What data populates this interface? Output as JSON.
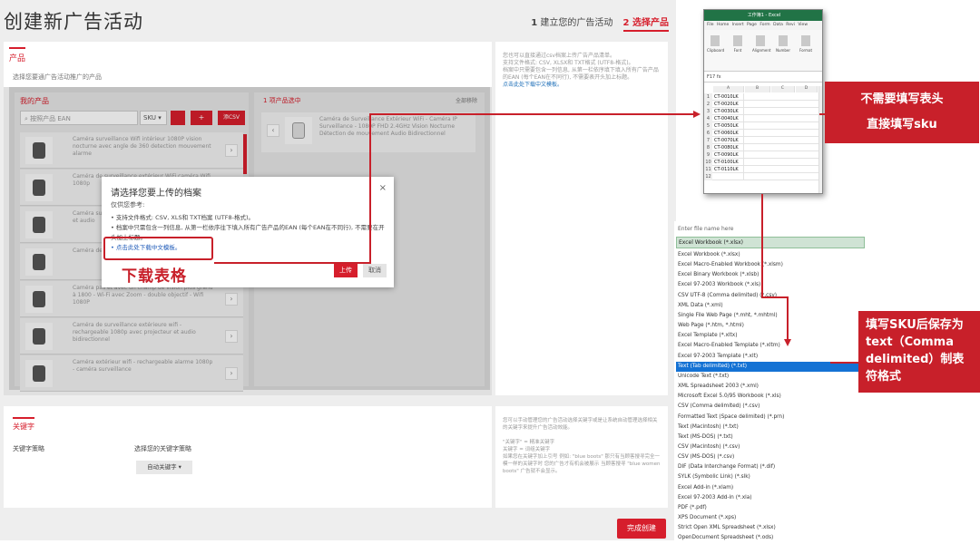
{
  "page": {
    "title": "创建新广告活动"
  },
  "steps": {
    "step1_num": "1",
    "step1": "建立您的广告活动",
    "step2_num": "2",
    "step2": "选择产品"
  },
  "products": {
    "tab": "产品",
    "subtitle": "选择您要通广告活动推广的产品",
    "my_products": {
      "header": "我的产品",
      "search_placeholder": "按照产品 EAN",
      "sku_select": "SKU ▾",
      "plus": "+",
      "csv": "添CSV",
      "items": [
        {
          "text": "Caméra surveillance Wifi intérieur 1080P vision nocturne avec angle de 360 detection mouvement alarme"
        },
        {
          "text": "Caméra de surveillance extérieur WiFi caméra Wifi 1080p"
        },
        {
          "text": "Caméra surveillance Wifi détection de mouvement et audio"
        },
        {
          "text": "Caméra de surveillance"
        },
        {
          "text": "Caméra pas et avec un champ de vision plus grand à 1800 - Wi-Fi avec Zoom - double objectif - Wifi 1080P"
        },
        {
          "text": "Caméra de surveillance extérieure wifi - rechargeable 1080p avec projecteur et audio bidirectionnel"
        },
        {
          "text": "Caméra extérieur wifi - rechargeable alarme 1080p - caméra surveillance"
        }
      ],
      "arrow": "›"
    },
    "selected": {
      "header": "1 项产品选中",
      "remove_all": "全部移除",
      "item_text": "Caméra de Surveillance Extérieur WiFi - Caméra IP Surveillance - 1080P FHD 2.4GHz Vision Nocturne Détection de mouvement Audio Bidirectionnel"
    },
    "info": {
      "lines": [
        "您也可以直接通过csv档案上传广告产品清单。",
        "支持文件格式: CSV, XLSX和 TXT格式 (UTF8-格式)。",
        "档案中只需要包含一列信息, 从第一栏依序填下填入所有广告产品的EAN (每个EAN在不同行), 不需要表开头加上标题。"
      ],
      "link": "点击此处下载中文模板。"
    }
  },
  "modal": {
    "title": "请选择您要上传的档案",
    "close": "×",
    "ref": "仅供您参考:",
    "bullets": [
      "支持文件格式: CSV, XLS和 TXT档案 (UTF8-格式)。",
      "档案中只需包含一列信息, 从第一栏依序往下填入所有广告产品的EAN (每个EAN在不同行), 不需要在开头加上标题。"
    ],
    "link": "点击此处下载中文模板。",
    "upload": "上传",
    "cancel": "取消"
  },
  "annotations": {
    "download": "下载表格",
    "note1_line1": "不需要填写表头",
    "note1_line2": "直接填写sku",
    "note2": "填写SKU后保存为text（Comma delimited）制表符格式"
  },
  "keywords": {
    "tab": "关键字",
    "strategy_label": "关键字策略",
    "strategy_header": "选择您的关键字策略",
    "auto_button": "自动关键字 ▾",
    "info_lines": [
      "您可以手动管理您的广告活动选择关键字或是让系统自动管理选择相关的关键字来提升广告活动效能。",
      "\"关键字\" = 精准关键字",
      "关键字 = 词组关键字",
      "如果您在关键字加上引号 例如: \"blue boots\" 那只有当顾客搜寻完全一模一样的关键字时 您的广告才有机会被展示 当顾客搜寻 \"blue women boots\" 广告就不会显示。"
    ]
  },
  "footer": {
    "finish": "完成创建"
  },
  "excel": {
    "title": "工作簿1 - Excel",
    "menu": "File Home Insert Page Form Data Revi View",
    "ribbon": [
      "Clipboard",
      "Font",
      "Alignment",
      "Number",
      "Format"
    ],
    "name_box": "F17",
    "fx": "fx",
    "columns": [
      "A",
      "B",
      "C",
      "D"
    ],
    "rows": [
      {
        "n": "1",
        "v": "CT-0010LK"
      },
      {
        "n": "2",
        "v": "CT-0020LK"
      },
      {
        "n": "3",
        "v": "CT-0030LK"
      },
      {
        "n": "4",
        "v": "CT-0040LK"
      },
      {
        "n": "5",
        "v": "CT-0050LK"
      },
      {
        "n": "6",
        "v": "CT-0060LK"
      },
      {
        "n": "7",
        "v": "CT-0070LK"
      },
      {
        "n": "8",
        "v": "CT-0080LK"
      },
      {
        "n": "9",
        "v": "CT-0090LK"
      },
      {
        "n": "10",
        "v": "CT-0100LK"
      },
      {
        "n": "11",
        "v": "CT-0110LK"
      },
      {
        "n": "12",
        "v": ""
      }
    ]
  },
  "saveas": {
    "input_placeholder": "Enter file name here",
    "current": "Excel Workbook (*.xlsx)",
    "options": [
      "Excel Workbook (*.xlsx)",
      "Excel Macro-Enabled Workbook (*.xlsm)",
      "Excel Binary Workbook (*.xlsb)",
      "Excel 97-2003 Workbook (*.xls)",
      "CSV UTF-8 (Comma delimited) (*.csv)",
      "XML Data (*.xml)",
      "Single File Web Page (*.mht, *.mhtml)",
      "Web Page (*.htm, *.html)",
      "Excel Template (*.xltx)",
      "Excel Macro-Enabled Template (*.xltm)",
      "Excel 97-2003 Template (*.xlt)",
      "Text (Tab delimited) (*.txt)",
      "Unicode Text (*.txt)",
      "XML Spreadsheet 2003 (*.xml)",
      "Microsoft Excel 5.0/95 Workbook (*.xls)",
      "CSV (Comma delimited) (*.csv)",
      "Formatted Text (Space delimited) (*.prn)",
      "Text (Macintosh) (*.txt)",
      "Text (MS-DOS) (*.txt)",
      "CSV (Macintosh) (*.csv)",
      "CSV (MS-DOS) (*.csv)",
      "DIF (Data Interchange Format) (*.dif)",
      "SYLK (Symbolic Link) (*.slk)",
      "Excel Add-in (*.xlam)",
      "Excel 97-2003 Add-in (*.xla)",
      "PDF (*.pdf)",
      "XPS Document (*.xps)",
      "Strict Open XML Spreadsheet (*.xlsx)",
      "OpenDocument Spreadsheet (*.ods)"
    ],
    "selected_index": 11
  },
  "colors": {
    "accent": "#d61e2c",
    "annotation": "#c8202a",
    "excel_green": "#217346",
    "list_select": "#1472d4"
  }
}
